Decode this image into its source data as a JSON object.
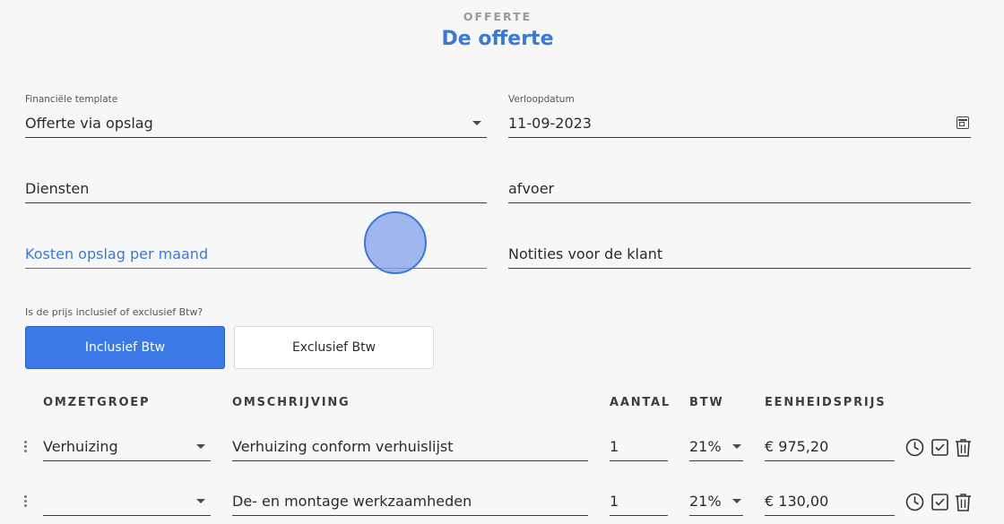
{
  "header": {
    "eyebrow": "OFFERTE",
    "title": "De offerte"
  },
  "form": {
    "template_label": "Financiële template",
    "template_value": "Offerte via opslag",
    "expiry_label": "Verloopdatum",
    "expiry_value": "11-09-2023",
    "services_value": "Diensten",
    "disposal_value": "afvoer",
    "cost_markup_placeholder": "Kosten opslag per maand",
    "client_notes_placeholder": "Notities voor de klant"
  },
  "vat": {
    "question": "Is de prijs inclusief of exclusief Btw?",
    "inclusive_label": "Inclusief Btw",
    "exclusive_label": "Exclusief Btw",
    "selected": "inclusive"
  },
  "table": {
    "headers": {
      "group": "OMZETGROEP",
      "description": "OMSCHRIJVING",
      "qty": "AANTAL",
      "vat": "BTW",
      "unit_price": "EENHEIDSPRIJS"
    },
    "rows": [
      {
        "group": "Verhuizing",
        "description": "Verhuizing conform verhuislijst",
        "qty": "1",
        "vat": "21%",
        "unit_price": "€ 975,20"
      },
      {
        "group": "",
        "description": "De- en montage werkzaamheden",
        "qty": "1",
        "vat": "21%",
        "unit_price": "€ 130,00"
      }
    ]
  },
  "colors": {
    "accent": "#3a79d6",
    "primary_button": "#3a79e6"
  },
  "icons": [
    "calendar-icon",
    "chevron-down-icon",
    "drag-handle-icon",
    "clock-icon",
    "checkbox-icon",
    "trash-icon"
  ]
}
